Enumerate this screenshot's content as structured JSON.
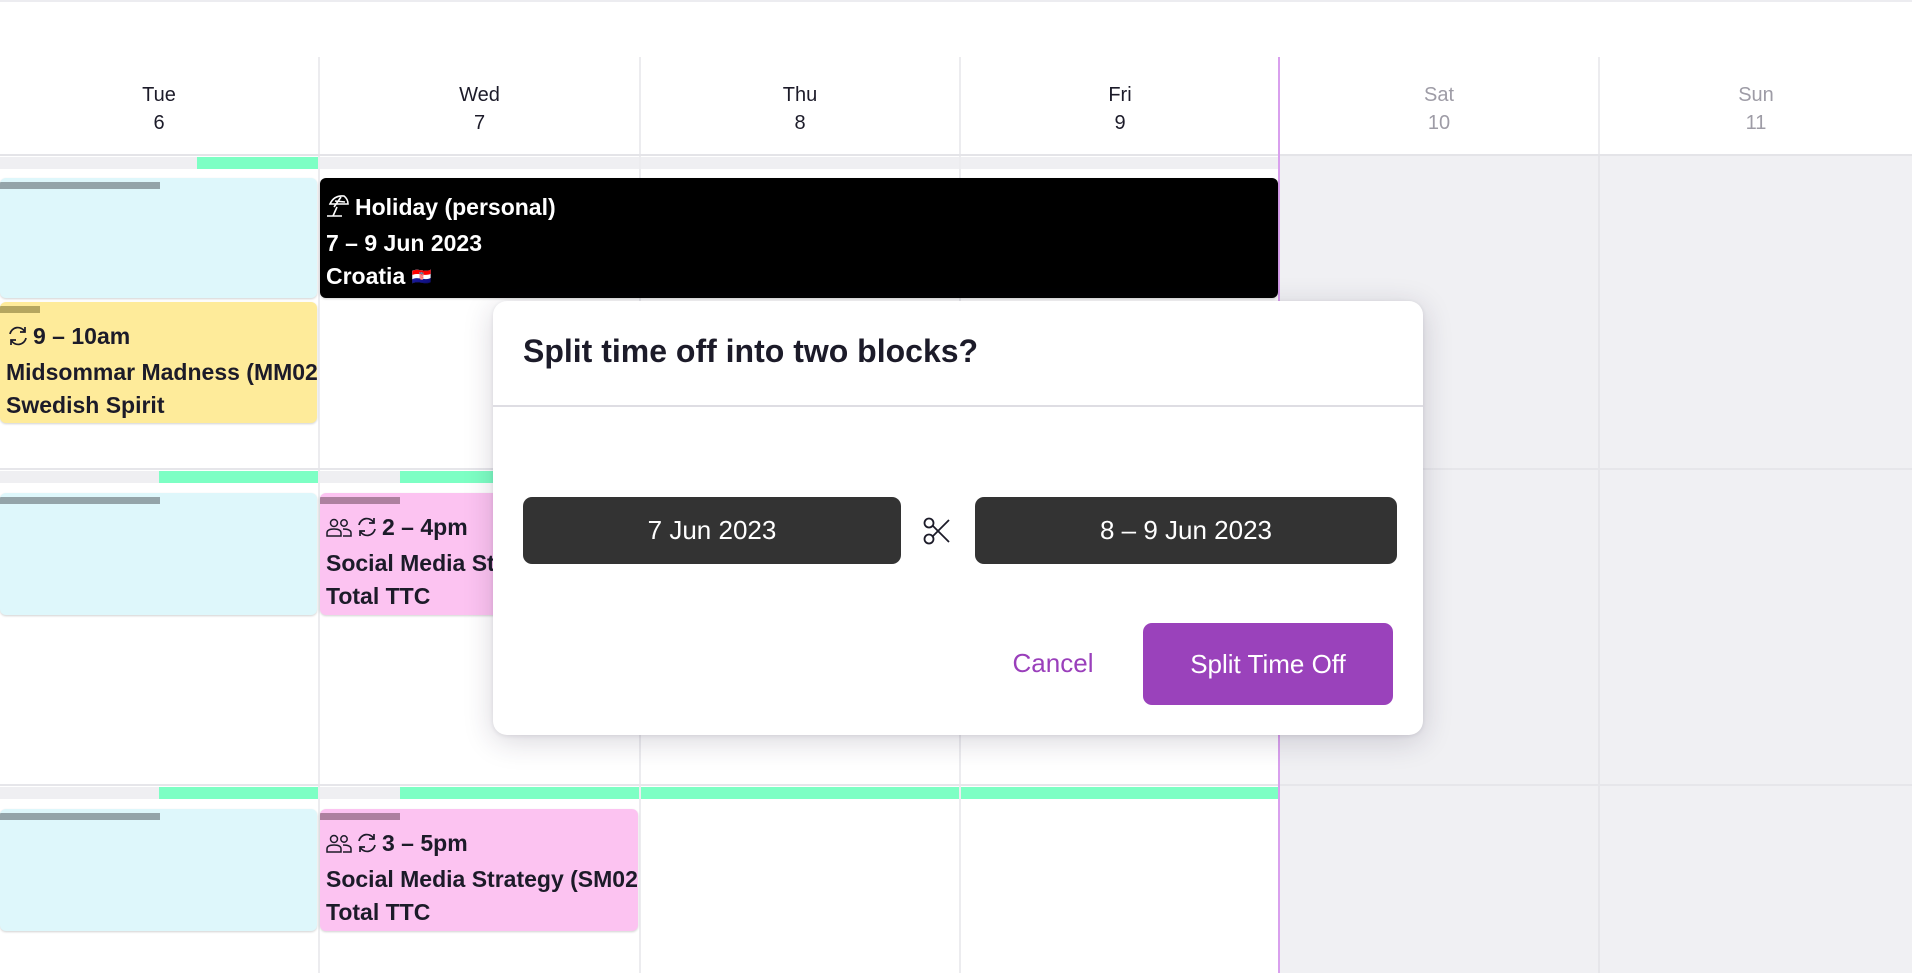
{
  "calendar": {
    "days": [
      {
        "name": "Tue",
        "num": "6",
        "weekend": false
      },
      {
        "name": "Wed",
        "num": "7",
        "weekend": false
      },
      {
        "name": "Thu",
        "num": "8",
        "weekend": false
      },
      {
        "name": "Fri",
        "num": "9",
        "weekend": false
      },
      {
        "name": "Sat",
        "num": "10",
        "weekend": true
      },
      {
        "name": "Sun",
        "num": "11",
        "weekend": true
      }
    ],
    "utilization": [
      [
        0.38,
        0.0,
        0.0,
        0.0
      ],
      [
        0.5,
        0.75,
        1.0,
        1.0
      ],
      [
        0.5,
        0.75,
        1.0,
        1.0
      ]
    ],
    "events": {
      "holiday": {
        "icon": "beach-umbrella-icon",
        "title": "Holiday (personal)",
        "dates": "7 – 9 Jun 2023",
        "location": "Croatia",
        "flag": "🇭🇷"
      },
      "midsommar": {
        "icon": "recurring-icon",
        "time": "9 – 10am",
        "title": "Midsommar Madness (MM02",
        "client": "Swedish Spirit"
      },
      "social_1": {
        "icons": [
          "team-icon",
          "recurring-icon"
        ],
        "time": "2 – 4pm",
        "title": "Social Media Strategy (SM02",
        "client": "Total TTC"
      },
      "social_2": {
        "icons": [
          "team-icon",
          "recurring-icon"
        ],
        "time": "3 – 5pm",
        "title": "Social Media Strategy (SM02",
        "client": "Total TTC"
      }
    },
    "colors": {
      "utilization": "#7dffc4",
      "today_line": "#d9a0ee",
      "blue_block": "#def7fb",
      "yellow_block": "#feeb9a",
      "pink_block": "#fcc3f1",
      "holiday_block": "#000000"
    }
  },
  "modal": {
    "title": "Split time off into two blocks?",
    "first_block": "7 Jun 2023",
    "second_block": "8 – 9 Jun 2023",
    "separator_icon": "scissors-icon",
    "cancel_label": "Cancel",
    "confirm_label": "Split Time Off",
    "accent_color": "#9a42bb"
  }
}
